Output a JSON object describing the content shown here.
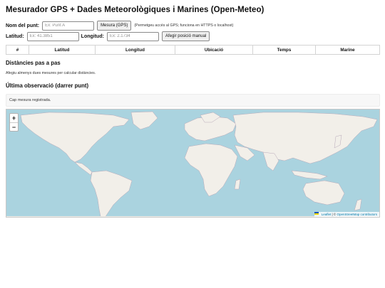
{
  "page": {
    "title": "Mesurador GPS + Dades Meteorològiques i Marines (Open-Meteo)"
  },
  "form": {
    "name_label": "Nom del punt:",
    "name_placeholder": "Ex: Punt A",
    "measure_button": "Mesura (GPS)",
    "gps_hint": "(Permetgeu accés al GPS; funciona en HTTPS o localhost)",
    "lat_label": "Latitud:",
    "lat_placeholder": "Ex: 41.3851",
    "lon_label": "Longitud:",
    "lon_placeholder": "Ex: 2.1734",
    "manual_button": "Afegir posició manual"
  },
  "table": {
    "columns": [
      "#",
      "Latitud",
      "Longitud",
      "Ubicació",
      "Temps",
      "Marine"
    ]
  },
  "distances": {
    "heading": "Distàncies pas a pas",
    "note": "Afegiu almenys dues mesures per calcular distàncies."
  },
  "last": {
    "heading": "Última observació (darrer punt)",
    "text": "Cap mesura registrada."
  },
  "map": {
    "zoom_in": "+",
    "zoom_out": "−",
    "attr_leaflet": "Leaflet",
    "attr_sep": " | © ",
    "attr_osm": "OpenStreetMap contributors",
    "colors": {
      "ocean": "#aad3df",
      "land": "#f2efe9",
      "border": "#b8a9b9",
      "link": "#0078a8"
    }
  }
}
